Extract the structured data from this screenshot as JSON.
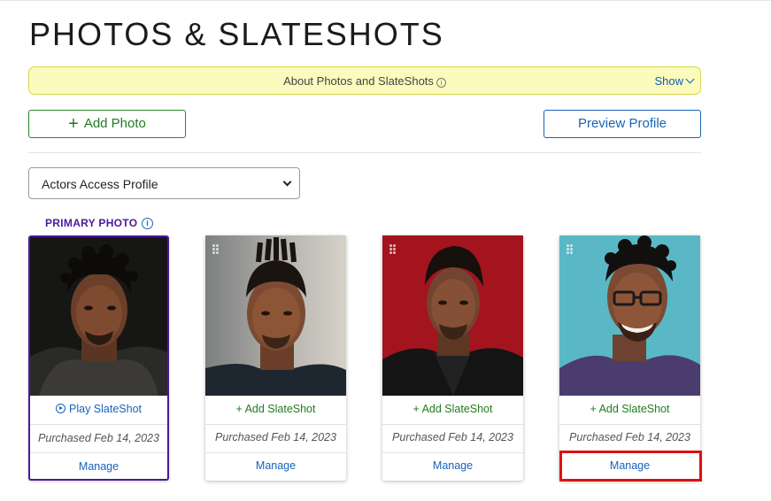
{
  "page": {
    "title": "PHOTOS & SLATESHOTS"
  },
  "about": {
    "text": "About Photos and SlateShots",
    "info_icon": "info-icon",
    "toggle_label": "Show"
  },
  "toolbar": {
    "add_photo_label": "Add Photo",
    "preview_label": "Preview Profile"
  },
  "profile_select": {
    "selected": "Actors Access Profile"
  },
  "primary": {
    "label": "PRIMARY PHOTO"
  },
  "photos": [
    {
      "action_label": "Play SlateShot",
      "action_type": "play",
      "purchased": "Purchased Feb 14, 2023",
      "manage_label": "Manage",
      "primary": true
    },
    {
      "action_label": "+ Add SlateShot",
      "action_type": "add",
      "purchased": "Purchased Feb 14, 2023",
      "manage_label": "Manage",
      "primary": false
    },
    {
      "action_label": "+ Add SlateShot",
      "action_type": "add",
      "purchased": "Purchased Feb 14, 2023",
      "manage_label": "Manage",
      "primary": false
    },
    {
      "action_label": "+ Add SlateShot",
      "action_type": "add",
      "purchased": "Purchased Feb 14, 2023",
      "manage_label": "Manage",
      "primary": false
    }
  ],
  "colors": {
    "primary_border": "#4a1a9c",
    "link": "#1763b8",
    "add_green": "#1f7d1f",
    "highlight": "#e01010",
    "about_bg": "#fbfbbd"
  }
}
